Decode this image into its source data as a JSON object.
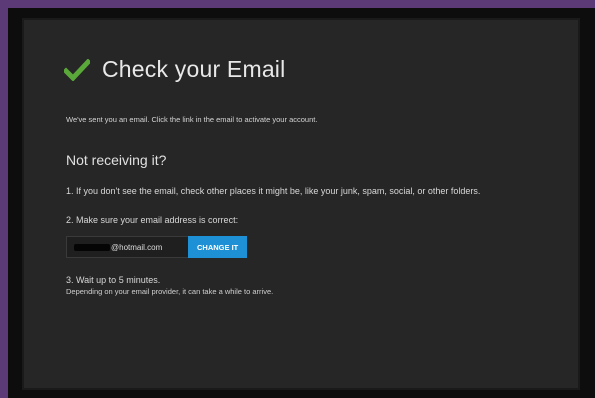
{
  "header": {
    "title": "Check your Email",
    "check_color": "#5aa83a"
  },
  "message": {
    "sent": "We've sent you an email. Click the link in the email to activate your account."
  },
  "help": {
    "heading": "Not receiving it?",
    "step1": "1. If you don't see the email, check other places it might be, like your junk, spam, social, or other folders.",
    "step2": "2. Make sure your email address is correct:",
    "email_value": "@hotmail.com",
    "change_button": "CHANGE IT",
    "step3": "3. Wait up to 5 minutes.",
    "step3_desc": "Depending on your email provider, it can take a while to arrive."
  },
  "colors": {
    "accent": "#1e90d6",
    "background": "#262626",
    "window_border": "#5c3a78"
  },
  "icons": {
    "check": "checkmark-icon"
  }
}
